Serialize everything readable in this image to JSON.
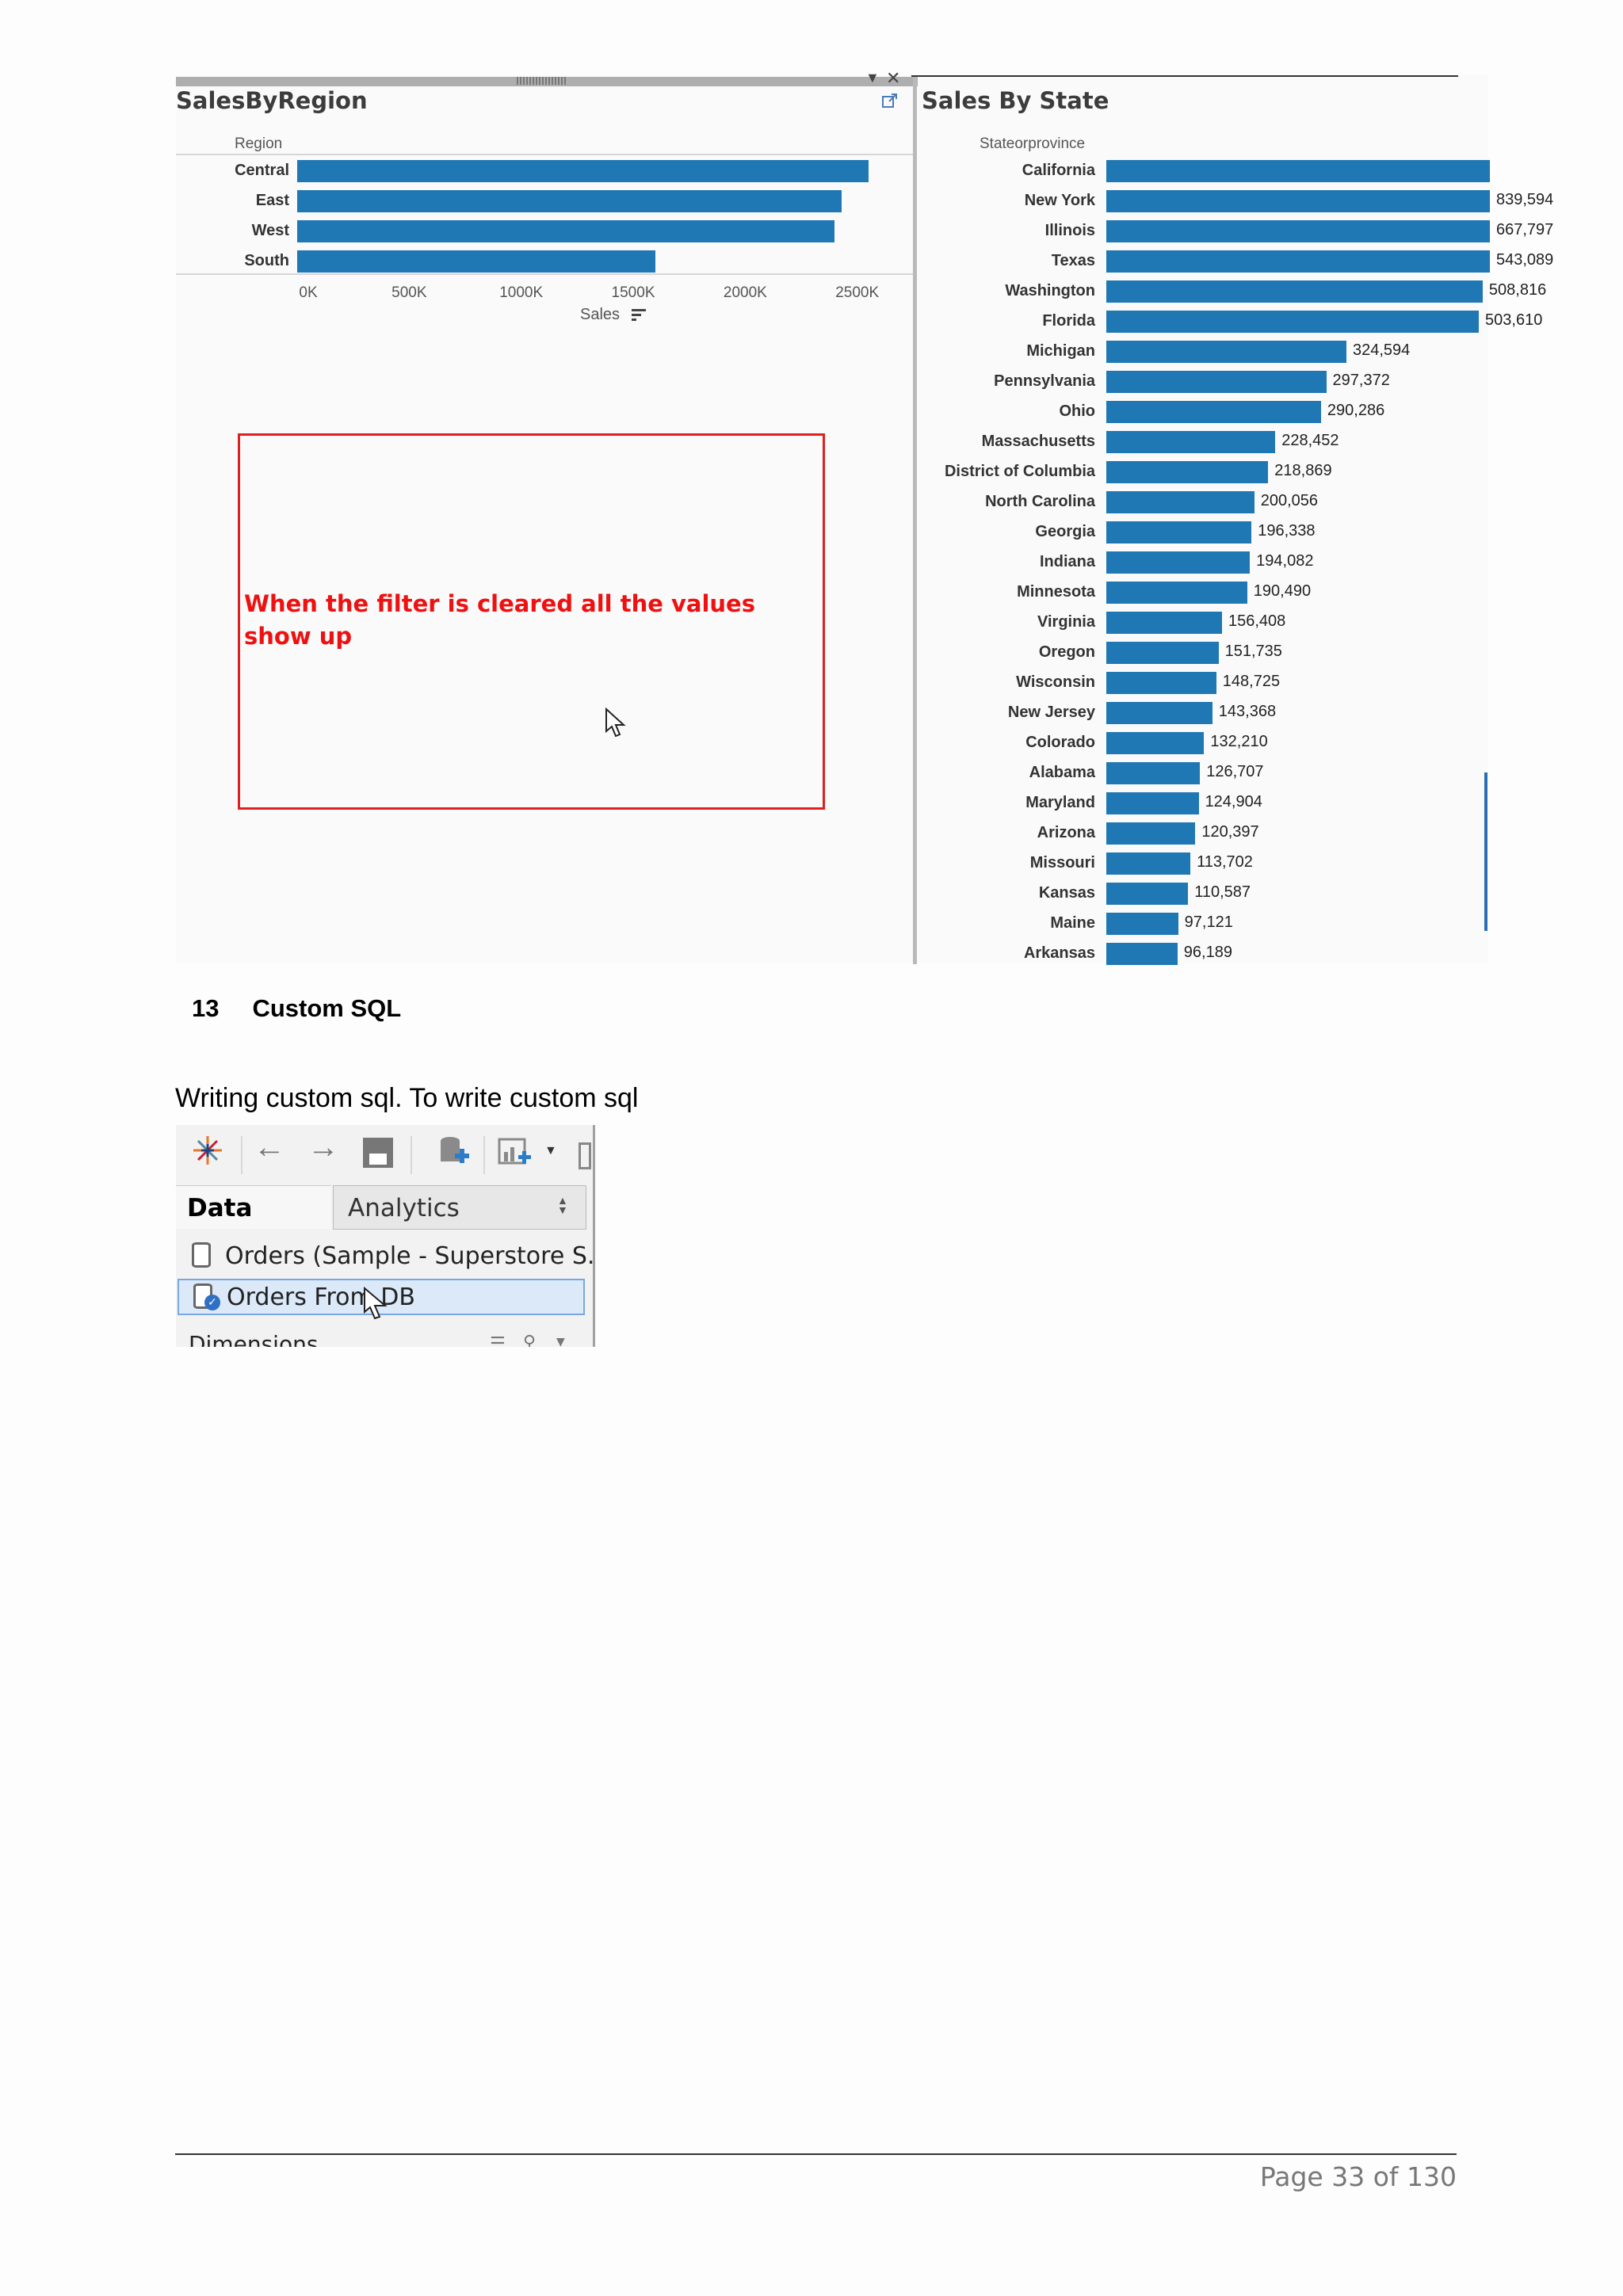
{
  "left_chart": {
    "title": "SalesByRegion",
    "dim_header": "Region",
    "axis_title": "Sales",
    "categories": [
      "Central",
      "East",
      "West",
      "South"
    ],
    "values": [
      2550000,
      2430000,
      2400000,
      1600000
    ],
    "ticks": [
      "0K",
      "500K",
      "1000K",
      "1500K",
      "2000K",
      "2500K"
    ],
    "tick_values": [
      0,
      500000,
      1000000,
      1500000,
      2000000,
      2500000
    ],
    "x_max": 2600000,
    "bar_color": "#1f77b4"
  },
  "right_chart": {
    "title": "Sales By State",
    "dim_header": "Stateorprovince",
    "bar_color": "#1f77b4",
    "x_max": 1200000,
    "rows": [
      {
        "state": "California",
        "value": 1300000,
        "label": ""
      },
      {
        "state": "New York",
        "value": 839594,
        "label": "839,594"
      },
      {
        "state": "Illinois",
        "value": 667797,
        "label": "667,797"
      },
      {
        "state": "Texas",
        "value": 543089,
        "label": "543,089"
      },
      {
        "state": "Washington",
        "value": 508816,
        "label": "508,816"
      },
      {
        "state": "Florida",
        "value": 503610,
        "label": "503,610"
      },
      {
        "state": "Michigan",
        "value": 324594,
        "label": "324,594"
      },
      {
        "state": "Pennsylvania",
        "value": 297372,
        "label": "297,372"
      },
      {
        "state": "Ohio",
        "value": 290286,
        "label": "290,286"
      },
      {
        "state": "Massachusetts",
        "value": 228452,
        "label": "228,452"
      },
      {
        "state": "District of Columbia",
        "value": 218869,
        "label": "218,869"
      },
      {
        "state": "North Carolina",
        "value": 200056,
        "label": "200,056"
      },
      {
        "state": "Georgia",
        "value": 196338,
        "label": "196,338"
      },
      {
        "state": "Indiana",
        "value": 194082,
        "label": "194,082"
      },
      {
        "state": "Minnesota",
        "value": 190490,
        "label": "190,490"
      },
      {
        "state": "Virginia",
        "value": 156408,
        "label": "156,408"
      },
      {
        "state": "Oregon",
        "value": 151735,
        "label": "151,735"
      },
      {
        "state": "Wisconsin",
        "value": 148725,
        "label": "148,725"
      },
      {
        "state": "New Jersey",
        "value": 143368,
        "label": "143,368"
      },
      {
        "state": "Colorado",
        "value": 132210,
        "label": "132,210"
      },
      {
        "state": "Alabama",
        "value": 126707,
        "label": "126,707"
      },
      {
        "state": "Maryland",
        "value": 124904,
        "label": "124,904"
      },
      {
        "state": "Arizona",
        "value": 120397,
        "label": "120,397"
      },
      {
        "state": "Missouri",
        "value": 113702,
        "label": "113,702"
      },
      {
        "state": "Kansas",
        "value": 110587,
        "label": "110,587"
      },
      {
        "state": "Maine",
        "value": 97121,
        "label": "97,121"
      },
      {
        "state": "Arkansas",
        "value": 96189,
        "label": "96,189"
      }
    ]
  },
  "annotation": {
    "text": "When the filter is cleared all the values show up",
    "color": "#ee1111"
  },
  "section": {
    "number": "13",
    "title": "Custom SQL"
  },
  "paragraph": "Writing custom sql. To write custom sql",
  "data_pane": {
    "tab_data": "Data",
    "tab_analytics": "Analytics",
    "datasources": [
      {
        "label": "Orders (Sample - Superstore S...",
        "selected": false
      },
      {
        "label": "Orders From DB",
        "selected": true
      }
    ],
    "partial_row": "Dimensions"
  },
  "footer": {
    "page": "Page 33 of 130"
  },
  "chart_data": [
    {
      "type": "bar",
      "title": "SalesByRegion",
      "xlabel": "Sales",
      "ylabel": "Region",
      "categories": [
        "Central",
        "East",
        "West",
        "South"
      ],
      "values": [
        2550000,
        2430000,
        2400000,
        1600000
      ],
      "xlim": [
        0,
        2600000
      ]
    },
    {
      "type": "bar",
      "title": "Sales By State",
      "ylabel": "Stateorprovince",
      "categories": [
        "California",
        "New York",
        "Illinois",
        "Texas",
        "Washington",
        "Florida",
        "Michigan",
        "Pennsylvania",
        "Ohio",
        "Massachusetts",
        "District of Columbia",
        "North Carolina",
        "Georgia",
        "Indiana",
        "Minnesota",
        "Virginia",
        "Oregon",
        "Wisconsin",
        "New Jersey",
        "Colorado",
        "Alabama",
        "Maryland",
        "Arizona",
        "Missouri",
        "Kansas",
        "Maine",
        "Arkansas"
      ],
      "values": [
        1300000,
        839594,
        667797,
        543089,
        508816,
        503610,
        324594,
        297372,
        290286,
        228452,
        218869,
        200056,
        196338,
        194082,
        190490,
        156408,
        151735,
        148725,
        143368,
        132210,
        126707,
        124904,
        120397,
        113702,
        110587,
        97121,
        96189
      ]
    }
  ]
}
